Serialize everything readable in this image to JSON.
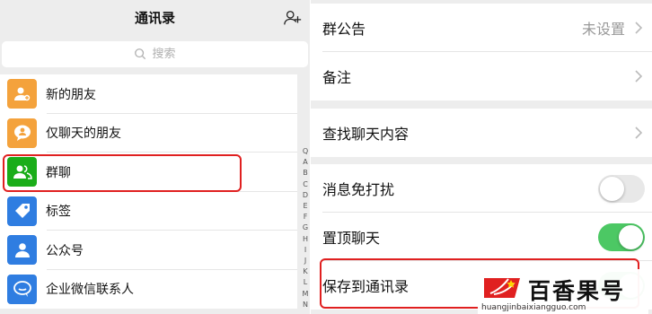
{
  "left": {
    "title": "通讯录",
    "search_placeholder": "搜索",
    "items": [
      {
        "label": "新的朋友",
        "icon": "add-friend-icon",
        "color": "#f4a23c"
      },
      {
        "label": "仅聊天的朋友",
        "icon": "chat-only-friend-icon",
        "color": "#f4a23c"
      },
      {
        "label": "群聊",
        "icon": "group-chat-icon",
        "color": "#1aad19"
      },
      {
        "label": "标签",
        "icon": "tag-icon",
        "color": "#2f7de1"
      },
      {
        "label": "公众号",
        "icon": "official-account-icon",
        "color": "#2f7de1"
      },
      {
        "label": "企业微信联系人",
        "icon": "work-contact-icon",
        "color": "#2f7de1"
      }
    ],
    "index_letters": [
      "Q",
      "A",
      "B",
      "C",
      "D",
      "E",
      "F",
      "G",
      "H",
      "I",
      "J",
      "K",
      "L",
      "M",
      "N"
    ]
  },
  "right": {
    "announcement": {
      "label": "群公告",
      "value": "未设置"
    },
    "remark": {
      "label": "备注"
    },
    "search_history": {
      "label": "查找聊天内容"
    },
    "mute": {
      "label": "消息免打扰",
      "enabled": false
    },
    "pin": {
      "label": "置顶聊天",
      "enabled": true
    },
    "save_to_contacts": {
      "label": "保存到通讯录",
      "enabled": true
    }
  },
  "watermark": {
    "brand": "百香果号",
    "url": "huangjinbaixiangguo.com"
  },
  "colors": {
    "highlight": "#e02020",
    "toggle_on": "#4cc864",
    "orange": "#f4a23c",
    "green": "#1aad19",
    "blue": "#2f7de1"
  }
}
